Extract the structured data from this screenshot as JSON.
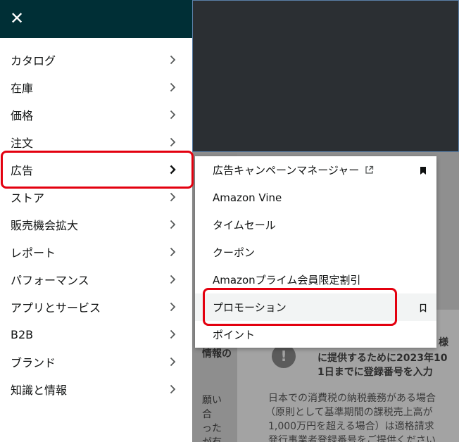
{
  "nav": {
    "close_label": "✕",
    "items": [
      {
        "label": "カタログ"
      },
      {
        "label": "在庫"
      },
      {
        "label": "価格"
      },
      {
        "label": "注文"
      },
      {
        "label": "広告"
      },
      {
        "label": "ストア"
      },
      {
        "label": "販売機会拡大"
      },
      {
        "label": "レポート"
      },
      {
        "label": "パフォーマンス"
      },
      {
        "label": "アプリとサービス"
      },
      {
        "label": "B2B"
      },
      {
        "label": "ブランド"
      },
      {
        "label": "知識と情報"
      }
    ]
  },
  "submenu": {
    "items": [
      {
        "label": "広告キャンペーンマネージャー",
        "external_icon": "external-link-icon",
        "bookmark": "bookmark-filled-icon"
      },
      {
        "label": "Amazon Vine"
      },
      {
        "label": "タイムセール"
      },
      {
        "label": "クーポン"
      },
      {
        "label": "Amazonプライム会員限定割引"
      },
      {
        "label": "プロモーション",
        "bookmark": "bookmark-outline-icon"
      },
      {
        "label": "ポイント"
      }
    ]
  },
  "background": {
    "lines": {
      "side_1": "情報の",
      "side_2": "願い",
      "side_3": "合",
      "side_4": "った",
      "side_5": "が有",
      "card_title_1": "様",
      "card_title_2": "に提供するために2023年10",
      "card_title_3": "1日までに登録番号を入力",
      "card_body_1": "日本での消費税の納税義務がある場合",
      "card_body_2": "（原則として基準期間の課税売上高が",
      "card_body_3": "1,000万円を超える場合）は適格請求",
      "card_body_4": "発行事業者登録番号をご提供ください"
    }
  },
  "colors": {
    "header_bg": "#002f36",
    "highlight": "#e3000f"
  }
}
